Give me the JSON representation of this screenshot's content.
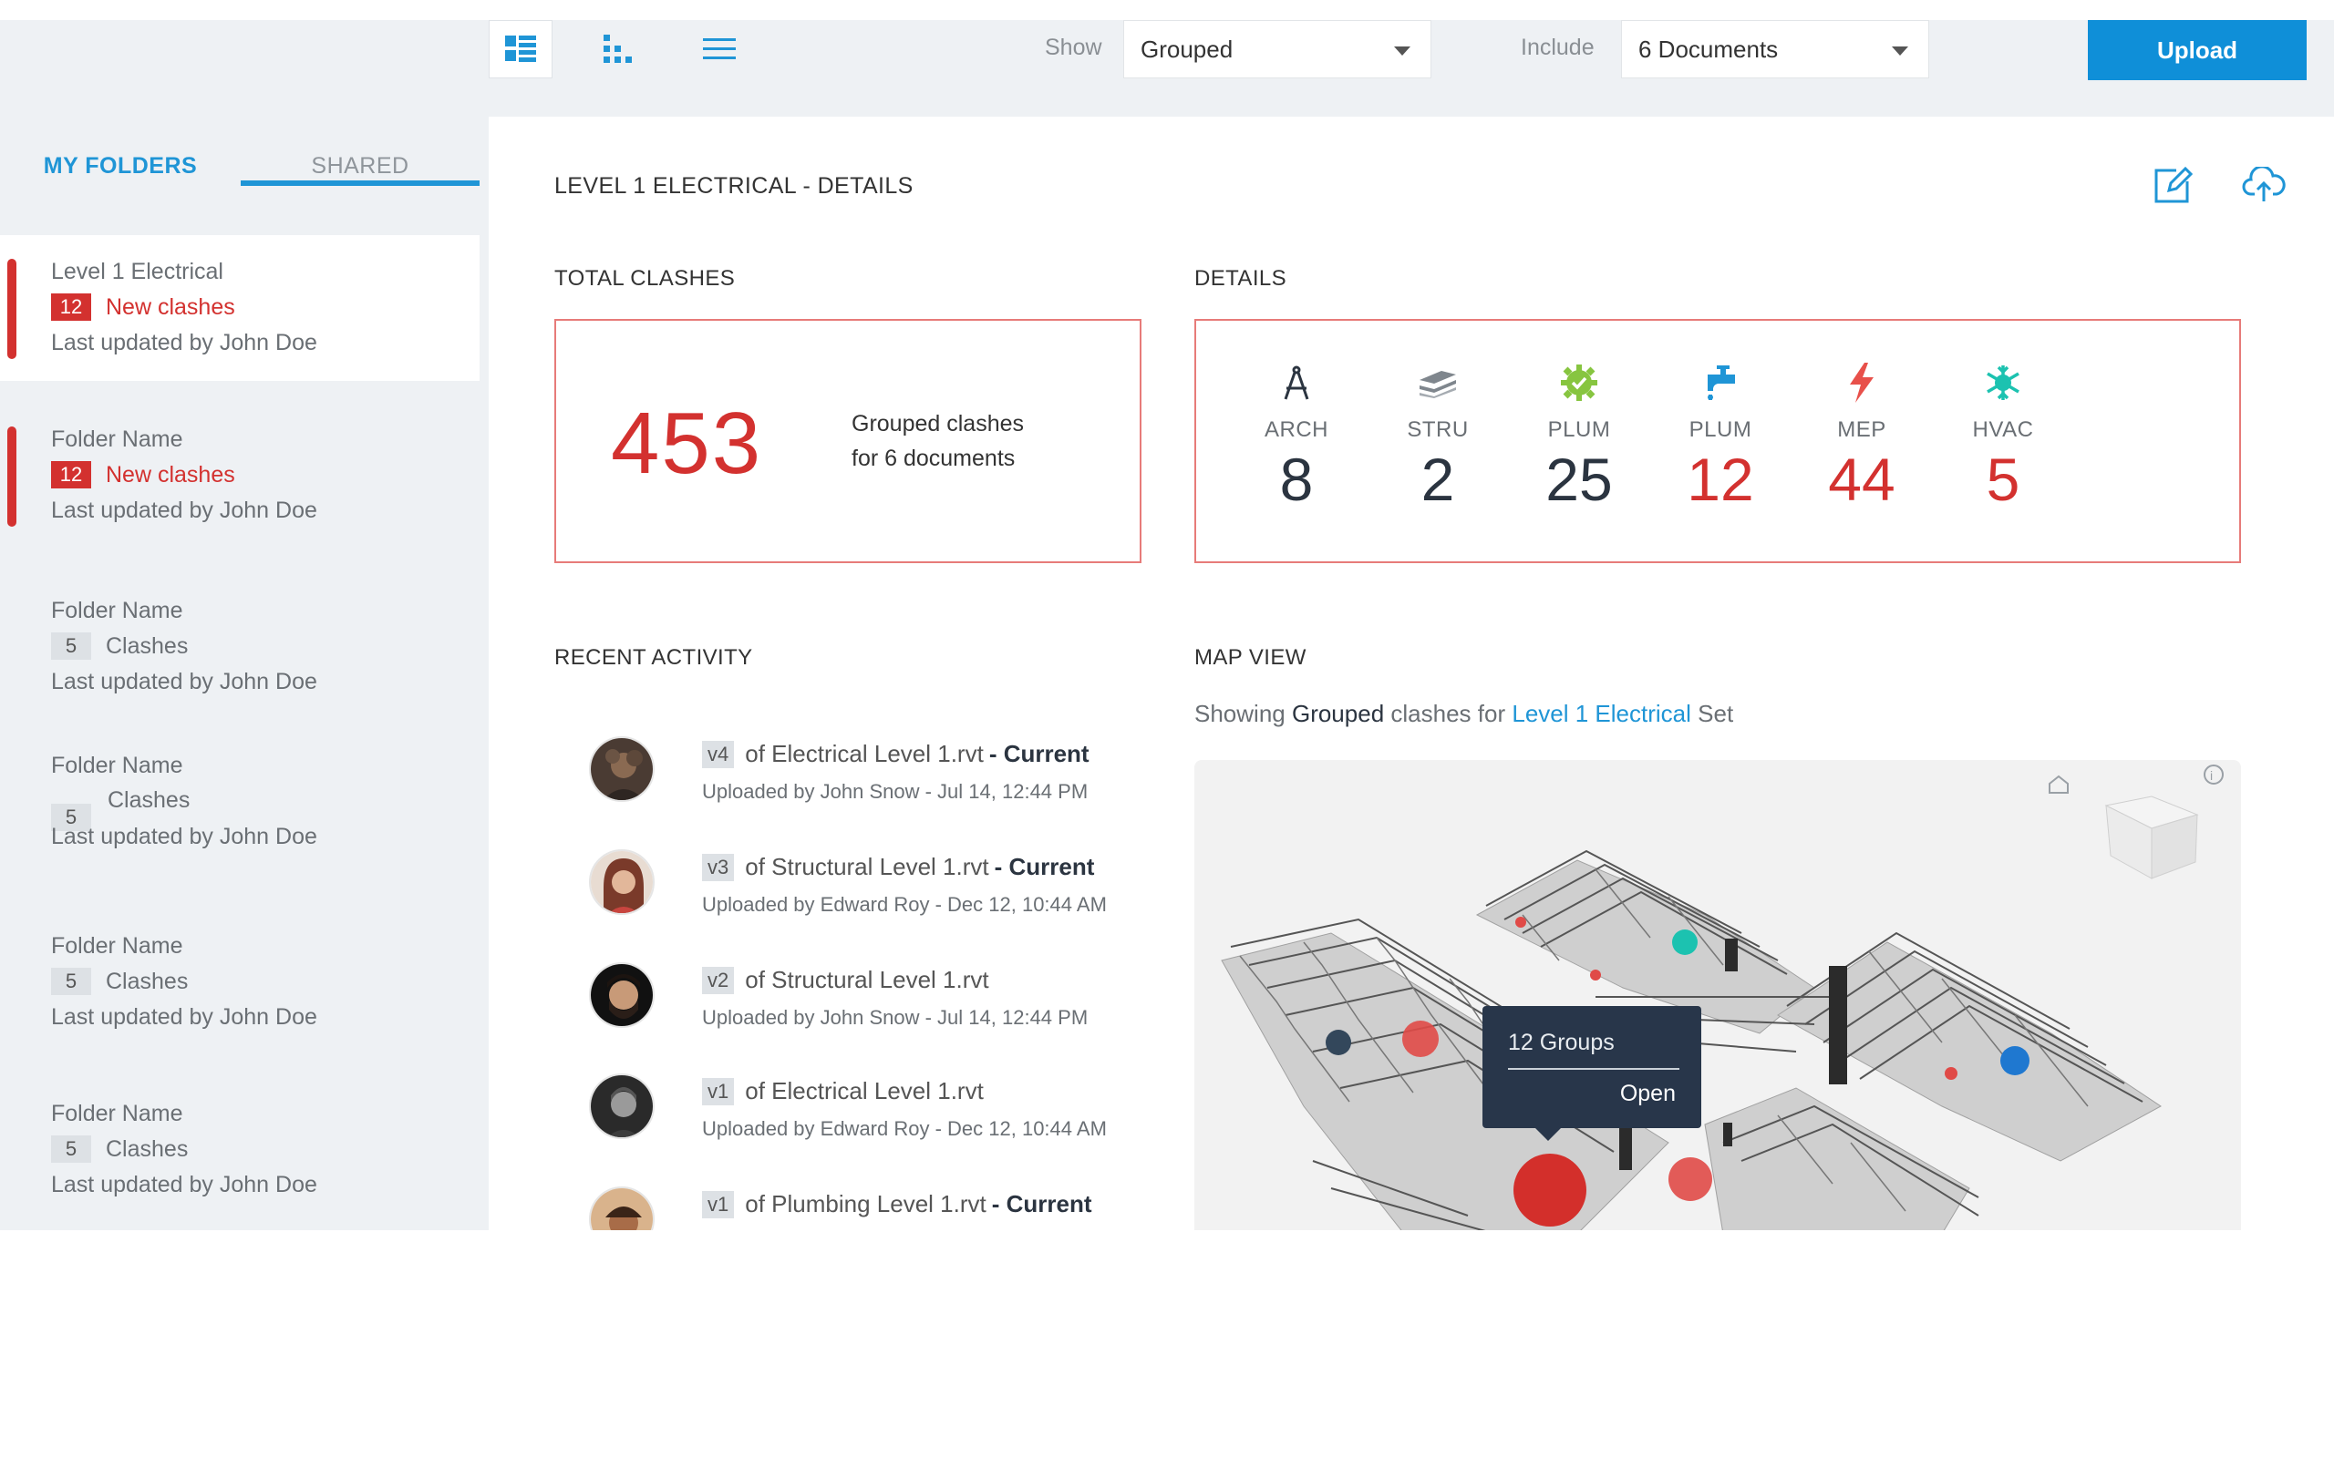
{
  "toolbar": {
    "show_label": "Show",
    "show_value": "Grouped",
    "include_label": "Include",
    "include_value": "6 Documents",
    "upload_label": "Upload"
  },
  "sidebar": {
    "tabs": [
      {
        "label": "MY FOLDERS",
        "active": true
      },
      {
        "label": "SHARED",
        "active": false
      }
    ],
    "folders": [
      {
        "name": "Level 1 Electrical",
        "count": "12",
        "count_label": "New clashes",
        "updated": "Last updated by John Doe",
        "status": "new"
      },
      {
        "name": "Folder Name",
        "count": "12",
        "count_label": "New clashes",
        "updated": "Last updated by John Doe",
        "status": "new"
      },
      {
        "name": "Folder Name",
        "count": "5",
        "count_label": "Clashes",
        "updated": "Last updated by John Doe",
        "status": "normal"
      },
      {
        "name": "Folder Name",
        "count": "5",
        "count_label": "Clashes",
        "updated": "Last updated by John Doe",
        "status": "normal"
      },
      {
        "name": "Folder Name",
        "count": "5",
        "count_label": "Clashes",
        "updated": "Last updated by John Doe",
        "status": "normal"
      },
      {
        "name": "Folder Name",
        "count": "5",
        "count_label": "Clashes",
        "updated": "Last updated by John Doe",
        "status": "normal"
      }
    ]
  },
  "main": {
    "title": "LEVEL 1 ELECTRICAL - DETAILS",
    "total": {
      "heading": "TOTAL CLASHES",
      "value": "453",
      "desc_line1": "Grouped clashes",
      "desc_line2": "for 6 documents"
    },
    "details": {
      "heading": "DETAILS",
      "disciplines": [
        {
          "label": "ARCH",
          "value": "8",
          "icon": "compass-icon",
          "color": "#2b3440",
          "alert": false
        },
        {
          "label": "STRU",
          "value": "2",
          "icon": "layers-icon",
          "color": "#6a6f74",
          "alert": false
        },
        {
          "label": "PLUM",
          "value": "25",
          "icon": "gear-icon",
          "color": "#87c540",
          "alert": false
        },
        {
          "label": "PLUM",
          "value": "12",
          "icon": "faucet-icon",
          "color": "#1f95d6",
          "alert": true
        },
        {
          "label": "MEP",
          "value": "44",
          "icon": "lightning-icon",
          "color": "#e8504a",
          "alert": true
        },
        {
          "label": "HVAC",
          "value": "5",
          "icon": "snowflake-icon",
          "color": "#1cc2b0",
          "alert": true
        }
      ]
    },
    "activity": {
      "heading": "RECENT ACTIVITY",
      "items": [
        {
          "version": "v4",
          "file": "of Electrical Level 1.rvt",
          "current": "- Current",
          "meta": "Uploaded by John Snow - Jul 14, 12:44 PM"
        },
        {
          "version": "v3",
          "file": "of Structural Level 1.rvt",
          "current": "- Current",
          "meta": "Uploaded by Edward Roy - Dec 12, 10:44 AM"
        },
        {
          "version": "v2",
          "file": "of Structural Level 1.rvt",
          "current": "",
          "meta": "Uploaded by John Snow - Jul 14, 12:44 PM"
        },
        {
          "version": "v1",
          "file": "of Electrical Level 1.rvt",
          "current": "",
          "meta": "Uploaded by Edward Roy - Dec 12, 10:44 AM"
        },
        {
          "version": "v1",
          "file": "of Plumbing Level 1.rvt",
          "current": "- Current",
          "meta": ""
        }
      ]
    },
    "map": {
      "heading": "MAP VIEW",
      "caption_prefix": "Showing",
      "caption_mode": "Grouped",
      "caption_mid": "clashes for",
      "caption_set": "Level 1 Electrical",
      "caption_suffix": "Set",
      "tooltip_title": "12 Groups",
      "tooltip_action": "Open"
    }
  },
  "colors": {
    "accent": "#1f95d6",
    "alert": "#d3312f",
    "upload": "#0f8fd8",
    "tooltip": "#28364a"
  }
}
